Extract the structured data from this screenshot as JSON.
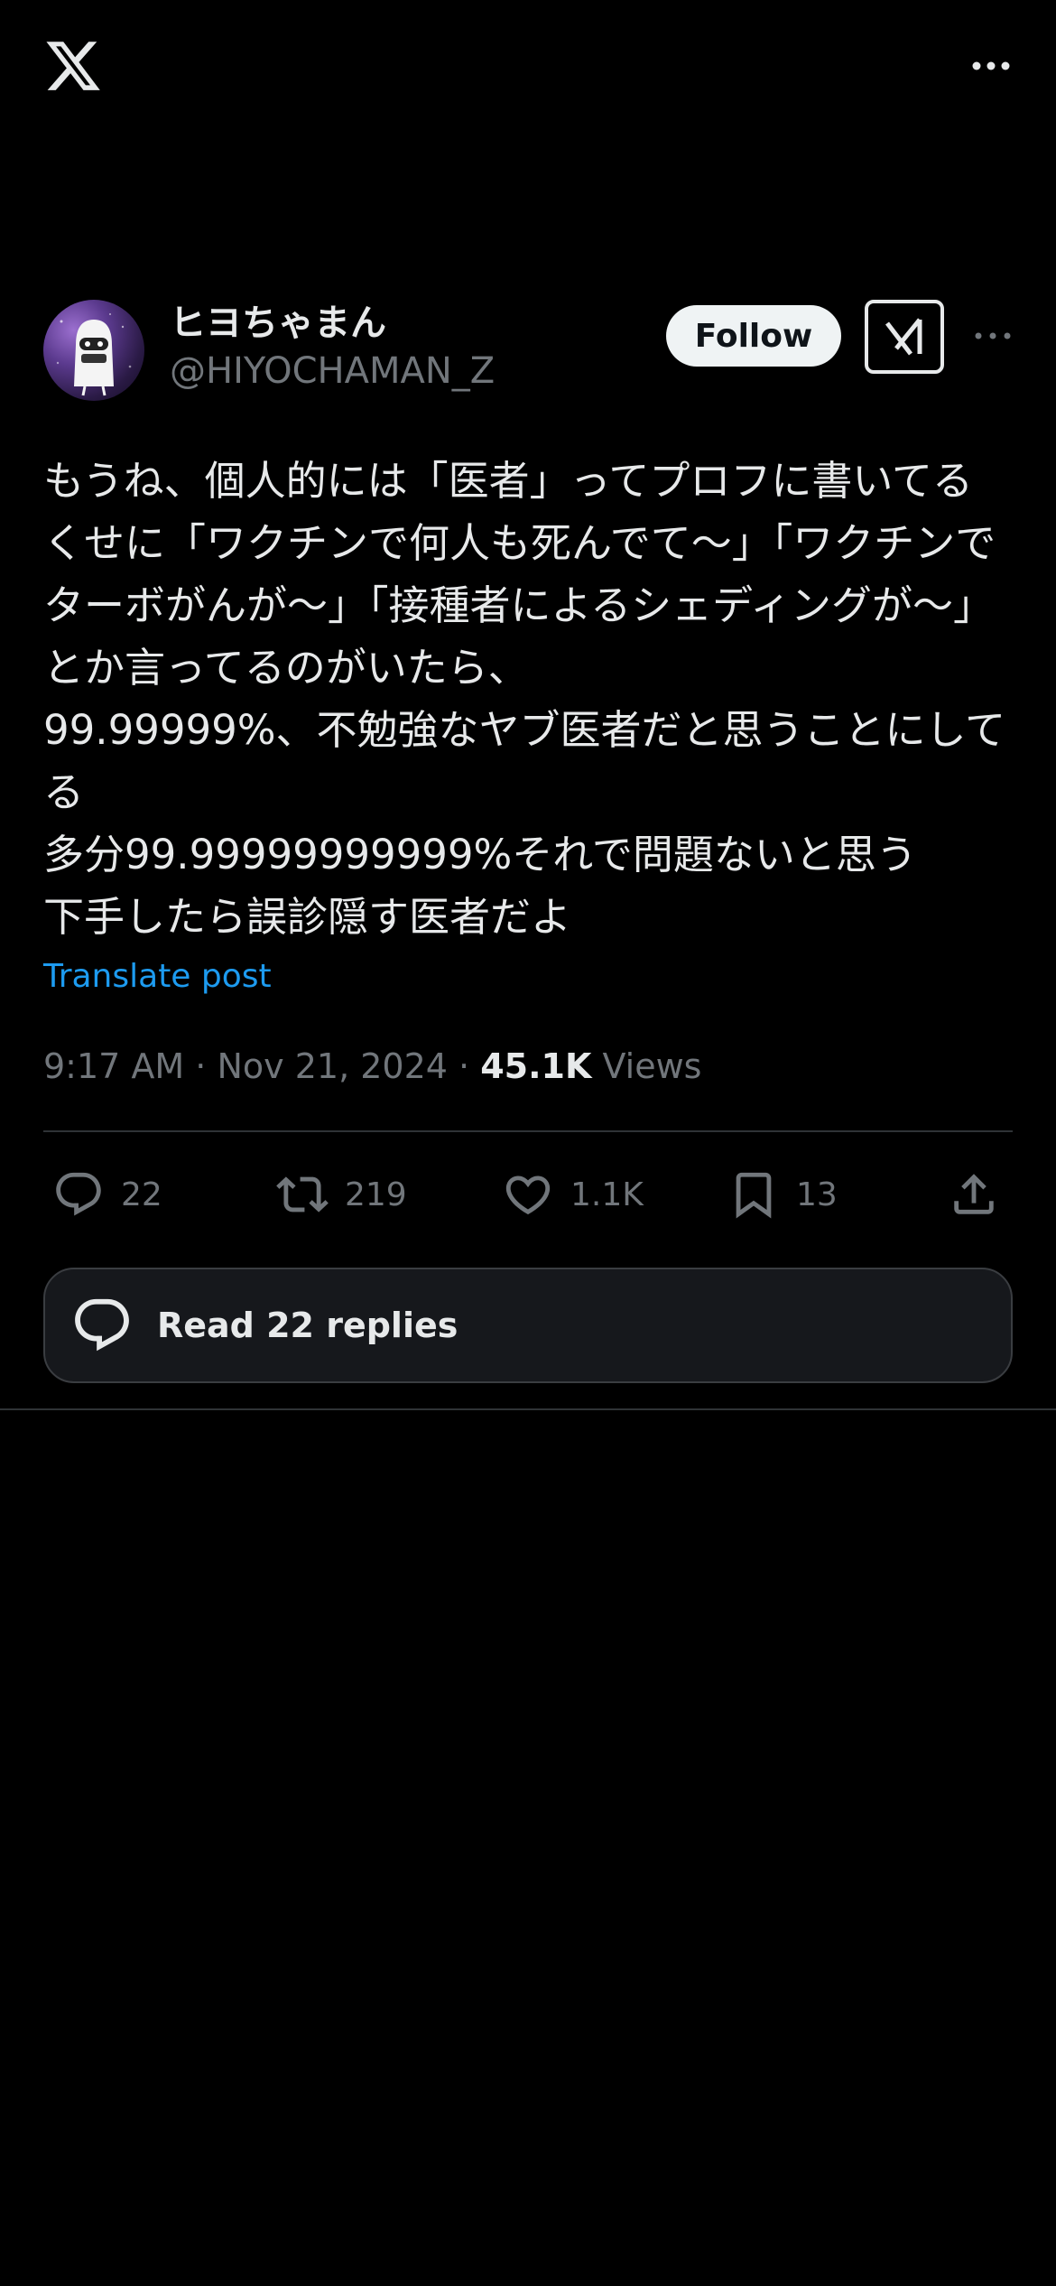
{
  "header": {
    "logo_icon": "x-logo-icon",
    "more_icon": "more-horizontal-icon"
  },
  "tweet": {
    "author": {
      "display_name": "ヒヨちゃまん",
      "handle": "@HIYOCHAMAN_Z",
      "follow_label": "Follow",
      "grok_icon": "grok-icon",
      "more_icon": "more-horizontal-icon"
    },
    "body": "もうね、個人的には「医者」ってプロフに書いてるくせに「ワクチンで何人も死んでて〜」「ワクチンでターボがんが〜」「接種者によるシェディングが〜」とか言ってるのがいたら、\n99.99999%、不勉強なヤブ医者だと思うことにしてる\n多分99.99999999999%それで問題ないと思う\n下手したら誤診隠す医者だよ",
    "translate_label": "Translate post",
    "time": "9:17 AM",
    "date": "Nov 21, 2024",
    "views_count": "45.1K",
    "views_label": "Views",
    "actions": {
      "replies": "22",
      "reposts": "219",
      "likes": "1.1K",
      "bookmarks": "13"
    }
  },
  "read_replies_label": "Read 22 replies",
  "colors": {
    "background": "#000000",
    "accent": "#1d9bf0",
    "muted": "#71767b",
    "text": "#e7e9ea"
  }
}
